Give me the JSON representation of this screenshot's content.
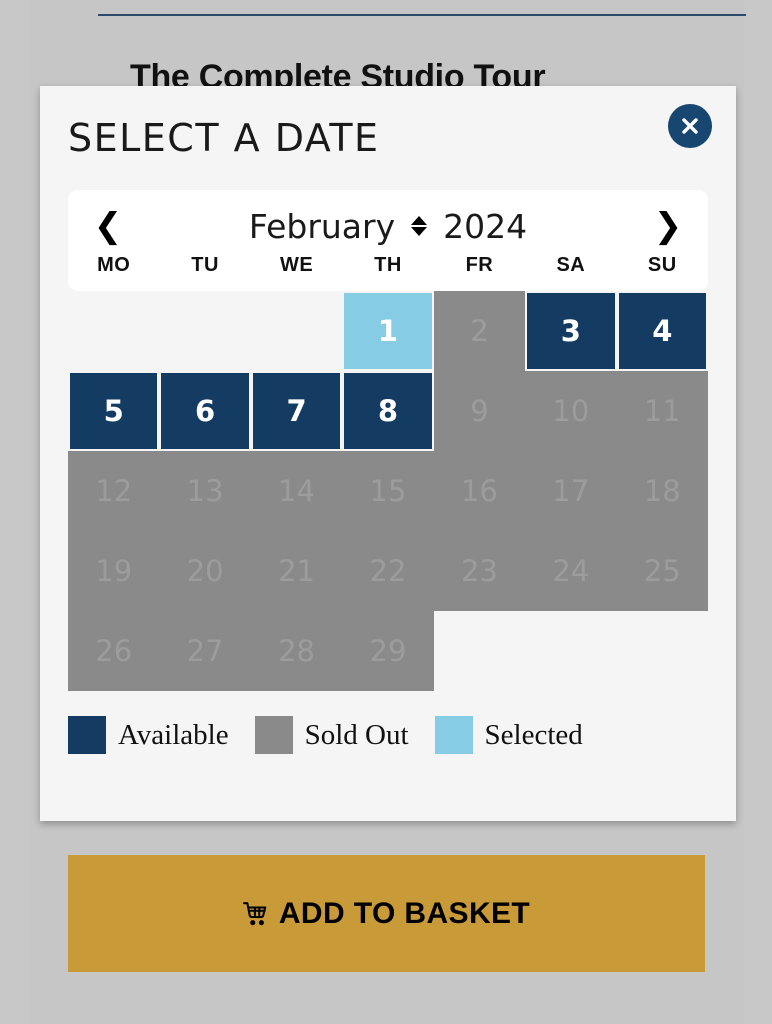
{
  "background_page": {
    "heading": "The Complete Studio Tour"
  },
  "modal": {
    "title": "SELECT A DATE",
    "close_label": "×",
    "close_icon": "close-x-icon"
  },
  "calendar": {
    "prev_icon": "❮",
    "next_icon": "❯",
    "month": "February",
    "year": "2024",
    "sort_icon": "sort-updown-icon",
    "day_headers": [
      "MO",
      "TU",
      "WE",
      "TH",
      "FR",
      "SA",
      "SU"
    ],
    "weeks": [
      [
        {
          "day": "",
          "state": "empty"
        },
        {
          "day": "",
          "state": "empty"
        },
        {
          "day": "",
          "state": "empty"
        },
        {
          "day": "1",
          "state": "selected"
        },
        {
          "day": "2",
          "state": "soldout"
        },
        {
          "day": "3",
          "state": "available"
        },
        {
          "day": "4",
          "state": "available"
        }
      ],
      [
        {
          "day": "5",
          "state": "available"
        },
        {
          "day": "6",
          "state": "available"
        },
        {
          "day": "7",
          "state": "available"
        },
        {
          "day": "8",
          "state": "available"
        },
        {
          "day": "9",
          "state": "soldout"
        },
        {
          "day": "10",
          "state": "soldout"
        },
        {
          "day": "11",
          "state": "soldout"
        }
      ],
      [
        {
          "day": "12",
          "state": "soldout"
        },
        {
          "day": "13",
          "state": "soldout"
        },
        {
          "day": "14",
          "state": "soldout"
        },
        {
          "day": "15",
          "state": "soldout"
        },
        {
          "day": "16",
          "state": "soldout"
        },
        {
          "day": "17",
          "state": "soldout"
        },
        {
          "day": "18",
          "state": "soldout"
        }
      ],
      [
        {
          "day": "19",
          "state": "soldout"
        },
        {
          "day": "20",
          "state": "soldout"
        },
        {
          "day": "21",
          "state": "soldout"
        },
        {
          "day": "22",
          "state": "soldout"
        },
        {
          "day": "23",
          "state": "soldout"
        },
        {
          "day": "24",
          "state": "soldout"
        },
        {
          "day": "25",
          "state": "soldout"
        }
      ],
      [
        {
          "day": "26",
          "state": "soldout"
        },
        {
          "day": "27",
          "state": "soldout"
        },
        {
          "day": "28",
          "state": "soldout"
        },
        {
          "day": "29",
          "state": "soldout"
        },
        {
          "day": "",
          "state": "empty"
        },
        {
          "day": "",
          "state": "empty"
        },
        {
          "day": "",
          "state": "empty"
        }
      ]
    ]
  },
  "legend": [
    {
      "label": "Available",
      "color": "#143c62",
      "swatch_class": "sw-available"
    },
    {
      "label": "Sold Out",
      "color": "#8a8a8a",
      "swatch_class": "sw-soldout"
    },
    {
      "label": "Selected",
      "color": "#86cce4",
      "swatch_class": "sw-selected"
    }
  ],
  "basket_button": {
    "label": "ADD TO BASKET",
    "icon": "shopping-cart-icon",
    "color": "#c99a38"
  },
  "colors": {
    "available": "#143c62",
    "soldout": "#8a8a8a",
    "selected": "#86cce4",
    "accent_gold": "#c99a38",
    "page_background": "#c8c8c8",
    "modal_background": "#f5f5f5"
  }
}
